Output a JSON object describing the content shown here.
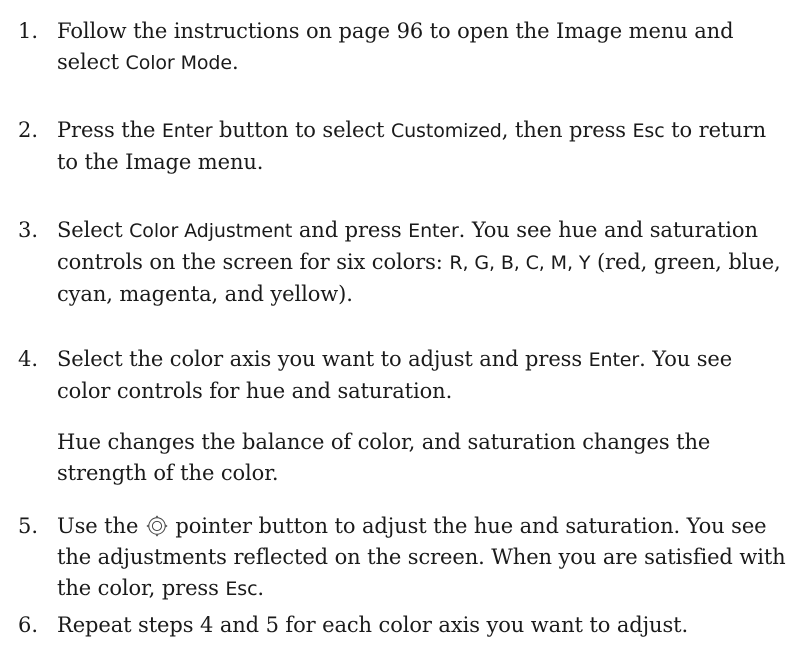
{
  "steps": [
    {
      "num": "1.",
      "t1": "Follow the instructions on page 96 to open the Image menu and select ",
      "ui1": "Color Mode",
      "t2": "."
    },
    {
      "num": "2.",
      "t1": "Press the ",
      "ui1": "Enter",
      "t2": " button to select ",
      "ui2": "Customized",
      "t3": ", then press ",
      "ui3": "Esc",
      "t4": " to return to the Image menu."
    },
    {
      "num": "3.",
      "t1": "Select ",
      "ui1": "Color Adjustment",
      "t2": " and press ",
      "ui2": "Enter",
      "t3": ". You see hue and saturation controls on the screen for six colors: ",
      "ui3": "R, G, B, C, M, Y",
      "t4": " (red, green, blue, cyan, magenta, and yellow)."
    },
    {
      "num": "4.",
      "t1": "Select the color axis you want to adjust and press ",
      "ui1": "Enter",
      "t2": ". You see color controls for hue and saturation.",
      "note": "Hue changes the balance of color, and saturation changes the strength of the color."
    },
    {
      "num": "5.",
      "t1": "Use the ",
      "icon": "pointer-button-icon",
      "t2": " pointer button to adjust the hue and saturation. You see the adjustments reflected on the screen. When you are satisfied with the color, press ",
      "ui1": "Esc",
      "t3": "."
    },
    {
      "num": "6.",
      "t1": "Repeat steps 4 and 5 for each color axis you want to adjust."
    }
  ]
}
